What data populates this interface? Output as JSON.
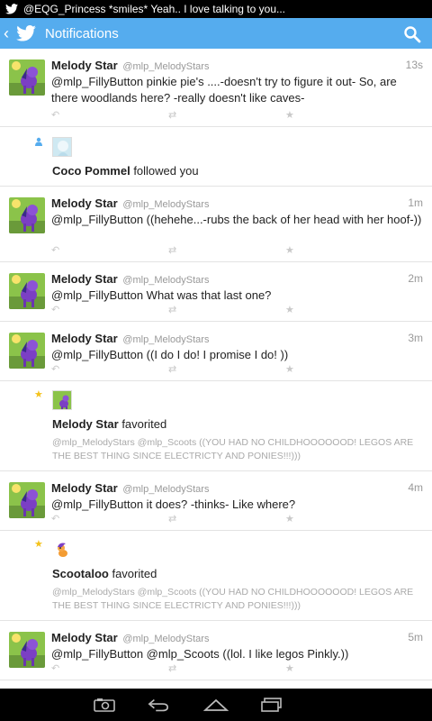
{
  "status_bar": {
    "ticker": "@EQG_Princess *smiles* Yeah.. I love talking to you..."
  },
  "app_bar": {
    "title": "Notifications"
  },
  "feed": [
    {
      "kind": "tweet",
      "name": "Melody Star",
      "handle": "@mlp_MelodyStars",
      "time": "13s",
      "text": "@mlp_FillyButton pinkie pie's ....-doesn't try to figure it out- So, are there woodlands here? -really doesn't like caves-"
    },
    {
      "kind": "follow",
      "user": "Coco Pommel",
      "action": "followed you"
    },
    {
      "kind": "tweet",
      "name": "Melody Star",
      "handle": "@mlp_MelodyStars",
      "time": "1m",
      "text": "@mlp_FillyButton ((hehehe...-rubs the back of her head with her hoof-))"
    },
    {
      "kind": "tweet",
      "name": "Melody Star",
      "handle": "@mlp_MelodyStars",
      "time": "2m",
      "text": "@mlp_FillyButton What was that last one?"
    },
    {
      "kind": "tweet",
      "name": "Melody Star",
      "handle": "@mlp_MelodyStars",
      "time": "3m",
      "text": "@mlp_FillyButton ((I do I do!  I promise I do! ))"
    },
    {
      "kind": "favorite",
      "user": "Melody Star",
      "action": "favorited",
      "quote": "@mlp_MelodyStars @mlp_Scoots ((YOU HAD NO CHILDHOOOOOOD! LEGOS ARE THE BEST THING SINCE ELECTRICTY AND PONIES!!!)))"
    },
    {
      "kind": "tweet",
      "name": "Melody Star",
      "handle": "@mlp_MelodyStars",
      "time": "4m",
      "text": "@mlp_FillyButton it does? -thinks- Like where?"
    },
    {
      "kind": "favorite",
      "user": "Scootaloo",
      "action": "favorited",
      "quote": "@mlp_MelodyStars @mlp_Scoots ((YOU HAD NO CHILDHOOOOOOD! LEGOS ARE THE BEST THING SINCE ELECTRICTY AND PONIES!!!)))"
    },
    {
      "kind": "tweet",
      "name": "Melody Star",
      "handle": "@mlp_MelodyStars",
      "time": "5m",
      "text": "@mlp_FillyButton @mlp_Scoots ((lol. I like legos Pinkly.))"
    }
  ],
  "colors": {
    "accent": "#55acee",
    "favorite_star": "#f4c21b",
    "follow_icon": "#55acee",
    "action_icons": "#c9c9c9"
  },
  "icons": {
    "reply": "reply-icon",
    "retweet": "retweet-icon",
    "favorite": "star-icon"
  }
}
